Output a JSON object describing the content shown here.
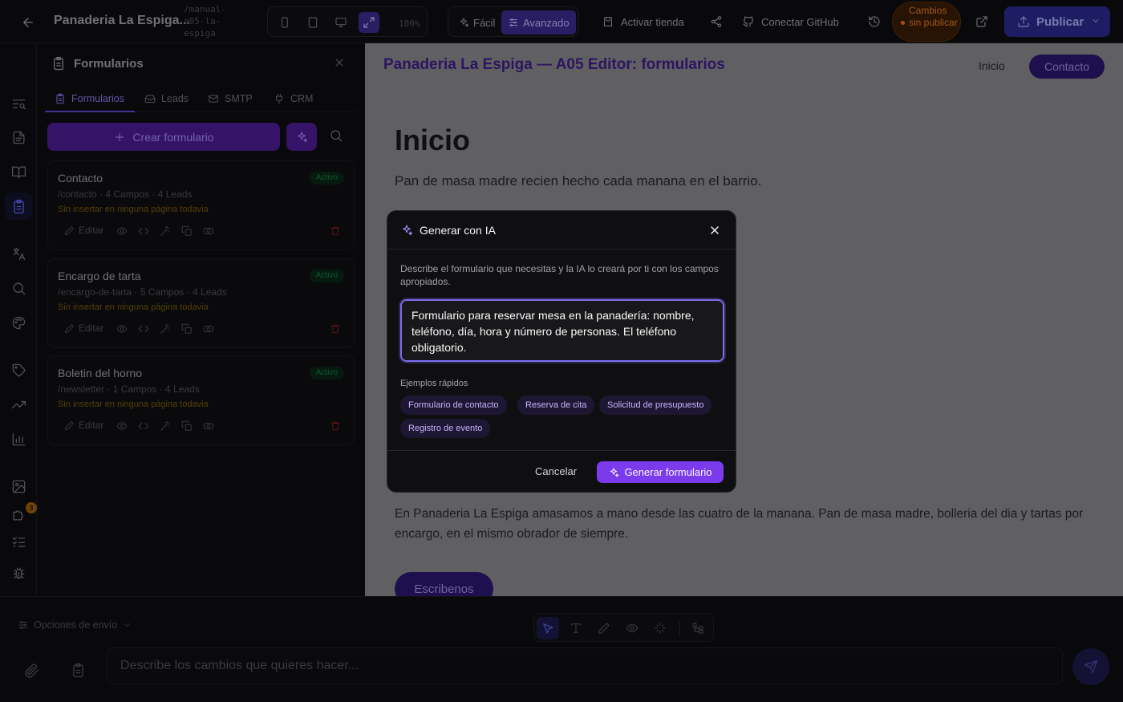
{
  "topbar": {
    "project_name": "Panaderia La Espiga...",
    "project_path": "/manual-a05-la-espiga",
    "zoom": "100%",
    "mode_easy": "Fácil",
    "mode_advanced": "Avanzado",
    "activate_store": "Activar tienda",
    "connect_github": "Conectar GitHub",
    "unsaved": "Cambios sin publicar",
    "publish": "Publicar"
  },
  "panel": {
    "title": "Formularios",
    "tabs": [
      {
        "label": "Formularios",
        "icon": "clipboard-icon"
      },
      {
        "label": "Leads",
        "icon": "inbox-icon"
      },
      {
        "label": "SMTP",
        "icon": "mail-icon"
      },
      {
        "label": "CRM",
        "icon": "plug-icon"
      }
    ],
    "create_label": "Crear formulario",
    "forms": [
      {
        "title": "Contacto",
        "meta": "/contacto · 4 Campos · 4 Leads",
        "warning": "Sin insertar en ninguna página todavia",
        "status": "Activo",
        "edit": "Editar"
      },
      {
        "title": "Encargo de tarta",
        "meta": "/encargo-de-tarta · 5 Campos · 4 Leads",
        "warning": "Sin insertar en ninguna página todavia",
        "status": "Activo",
        "edit": "Editar"
      },
      {
        "title": "Boletin del horno",
        "meta": "/newsletter · 1 Campos · 4 Leads",
        "warning": "Sin insertar en ninguna página todavia",
        "status": "Activo",
        "edit": "Editar"
      }
    ]
  },
  "rail": {
    "badge": "3"
  },
  "preview": {
    "brand": "Panaderia La Espiga — A05 Editor: formularios",
    "nav_home": "Inicio",
    "nav_contact": "Contacto",
    "hero_title": "Inicio",
    "hero_sub": "Pan de masa madre recien hecho cada manana en el barrio.",
    "about": "En Panaderia La Espiga amasamos a mano desde las cuatro de la manana. Pan de masa madre, bolleria del dia y tartas por encargo, en el mismo obrador de siempre.",
    "cta": "Escribenos"
  },
  "bottombar": {
    "send_options": "Opciones de envío",
    "prompt_placeholder": "Describe los cambios que quieres hacer..."
  },
  "modal": {
    "title": "Generar con IA",
    "description": "Describe el formulario que necesitas y la IA lo creará por ti con los campos apropiados.",
    "prompt_value": "Formulario para reservar mesa en la panadería: nombre, teléfono, día, hora y número de personas. El teléfono obligatorio.",
    "examples_label": "Ejemplos rápidos",
    "examples": [
      "Formulario de contacto",
      "Reserva de cita",
      "Solicitud de presupuesto",
      "Registro de evento"
    ],
    "cancel": "Cancelar",
    "generate": "Generar formulario"
  },
  "colors": {
    "accent": "#7c3aed",
    "active_badge": "#15803d",
    "warning": "#ea7a1e"
  }
}
